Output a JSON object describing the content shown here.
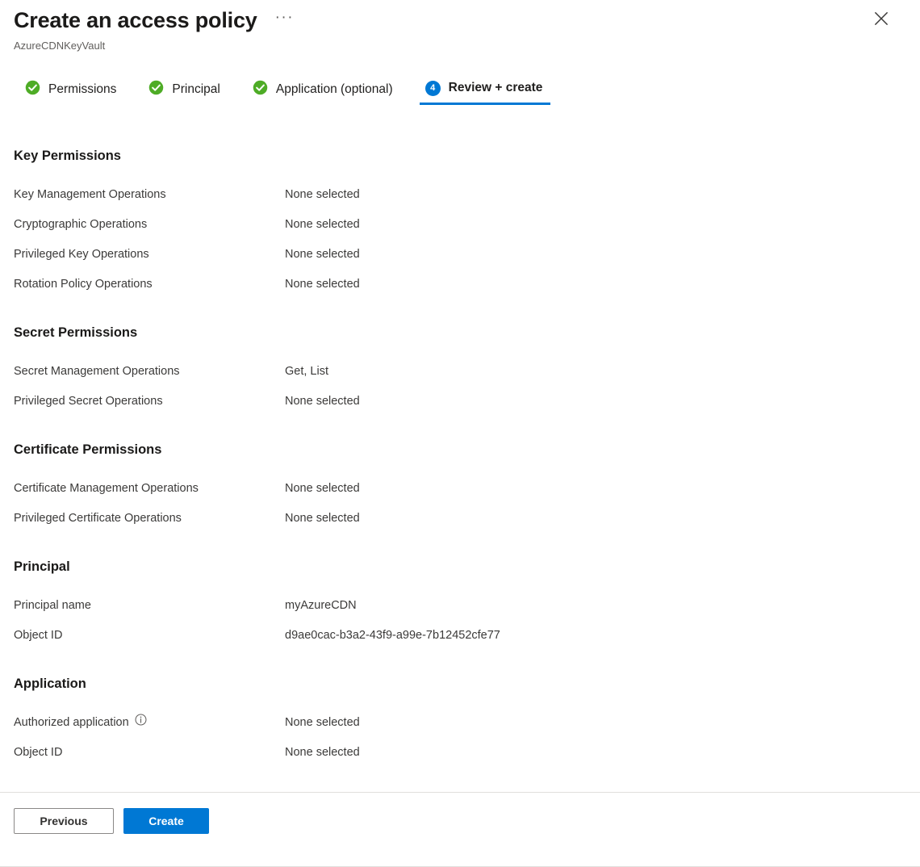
{
  "header": {
    "title": "Create an access policy",
    "subtitle": "AzureCDNKeyVault",
    "more_label": "···",
    "close_icon": "close-icon",
    "more_icon": "ellipsis-icon"
  },
  "tabs": [
    {
      "label": "Permissions",
      "state": "complete",
      "icon": "check-circle-icon",
      "badge": ""
    },
    {
      "label": "Principal",
      "state": "complete",
      "icon": "check-circle-icon",
      "badge": ""
    },
    {
      "label": "Application (optional)",
      "state": "complete",
      "icon": "check-circle-icon",
      "badge": ""
    },
    {
      "label": "Review + create",
      "state": "active",
      "icon": "step-number-badge",
      "badge": "4"
    }
  ],
  "sections": [
    {
      "title": "Key Permissions",
      "rows": [
        {
          "label": "Key Management Operations",
          "value": "None selected",
          "info": false
        },
        {
          "label": "Cryptographic Operations",
          "value": "None selected",
          "info": false
        },
        {
          "label": "Privileged Key Operations",
          "value": "None selected",
          "info": false
        },
        {
          "label": "Rotation Policy Operations",
          "value": "None selected",
          "info": false
        }
      ]
    },
    {
      "title": "Secret Permissions",
      "rows": [
        {
          "label": "Secret Management Operations",
          "value": "Get, List",
          "info": false
        },
        {
          "label": "Privileged Secret Operations",
          "value": "None selected",
          "info": false
        }
      ]
    },
    {
      "title": "Certificate Permissions",
      "rows": [
        {
          "label": "Certificate Management Operations",
          "value": "None selected",
          "info": false
        },
        {
          "label": "Privileged Certificate Operations",
          "value": "None selected",
          "info": false
        }
      ]
    },
    {
      "title": "Principal",
      "rows": [
        {
          "label": "Principal name",
          "value": "myAzureCDN",
          "info": false
        },
        {
          "label": "Object ID",
          "value": "d9ae0cac-b3a2-43f9-a99e-7b12452cfe77",
          "info": false
        }
      ]
    },
    {
      "title": "Application",
      "rows": [
        {
          "label": "Authorized application",
          "value": "None selected",
          "info": true
        },
        {
          "label": "Object ID",
          "value": "None selected",
          "info": false
        }
      ]
    }
  ],
  "footer": {
    "previous_label": "Previous",
    "create_label": "Create"
  },
  "colors": {
    "accent": "#0078d4",
    "success": "#4eac26",
    "text": "#3b3a39",
    "heading": "#1b1a19",
    "subtle": "#605e5c",
    "divider": "#e1dfdd"
  }
}
